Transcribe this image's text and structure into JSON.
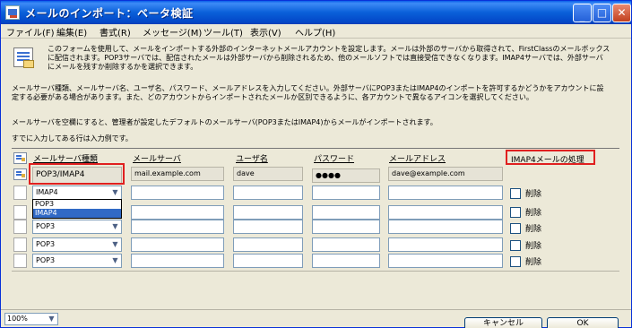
{
  "window": {
    "title": "メールのインポート：ベータ検証"
  },
  "menu": [
    "ファイル(F)",
    "編集(E)",
    "書式(R)",
    "メッセージ(M)",
    "ツール(T)",
    "表示(V)",
    "ヘルプ(H)"
  ],
  "intro": {
    "line1": "このフォームを使用して、メールをインポートする外部のインターネットメールアカウントを設定します。メールは外部のサーバから取得されて、FirstClassのメールボックス",
    "line2": "に配信されます。POP3サーバでは、配信されたメールは外部サーバから削除されるため、他のメールソフトでは直接受信できなくなります。IMAP4サーバでは、外部サーバ",
    "line3": "にメールを残すか削除するかを選択できます。",
    "line4": "メールサーバ種類、メールサーバ名、ユーザ名、パスワード、メールアドレスを入力してください。外部サーバにPOP3またはIMAP4のインポートを許可するかどうかをアカウントに設",
    "line5": "定する必要がある場合があります。また、どのアカウントからインポートされたメールか区別できるように、各アカウントで異なるアイコンを選択してください。",
    "line6": "メールサーバを空欄にすると、管理者が設定したデフォルトのメールサーバ(POP3またはIMAP4)からメールがインポートされます。",
    "line7": "すでに入力してある行は入力例です。"
  },
  "columns": {
    "server_type": "メールサーバ種類",
    "mail_server": "メールサーバ",
    "username": "ユーザ名",
    "password": "パスワード",
    "email": "メールアドレス",
    "imap_handling": "IMAP4メールの処理"
  },
  "example_row": {
    "server_type": "POP3/IMAP4",
    "mail_server": "mail.example.com",
    "username": "dave",
    "password": "●●●●",
    "email": "dave@example.com"
  },
  "rows": [
    {
      "server_type": "IMAP4",
      "delete_label": "削除",
      "delete_checked": false
    },
    {
      "server_type": "",
      "delete_label": "削除",
      "delete_checked": false
    },
    {
      "server_type": "POP3",
      "delete_label": "削除",
      "delete_checked": false
    },
    {
      "server_type": "POP3",
      "delete_label": "削除",
      "delete_checked": false
    },
    {
      "server_type": "POP3",
      "delete_label": "削除",
      "delete_checked": false
    }
  ],
  "dropdown": {
    "options": [
      "POP3",
      "IMAP4"
    ],
    "highlighted": "IMAP4"
  },
  "buttons": {
    "cancel": "キャンセル",
    "ok": "OK"
  },
  "status": {
    "zoom": "100%"
  },
  "colors": {
    "titlebar": "#0a5fd9",
    "highlight_border": "#e02020",
    "selection": "#316ac5"
  }
}
